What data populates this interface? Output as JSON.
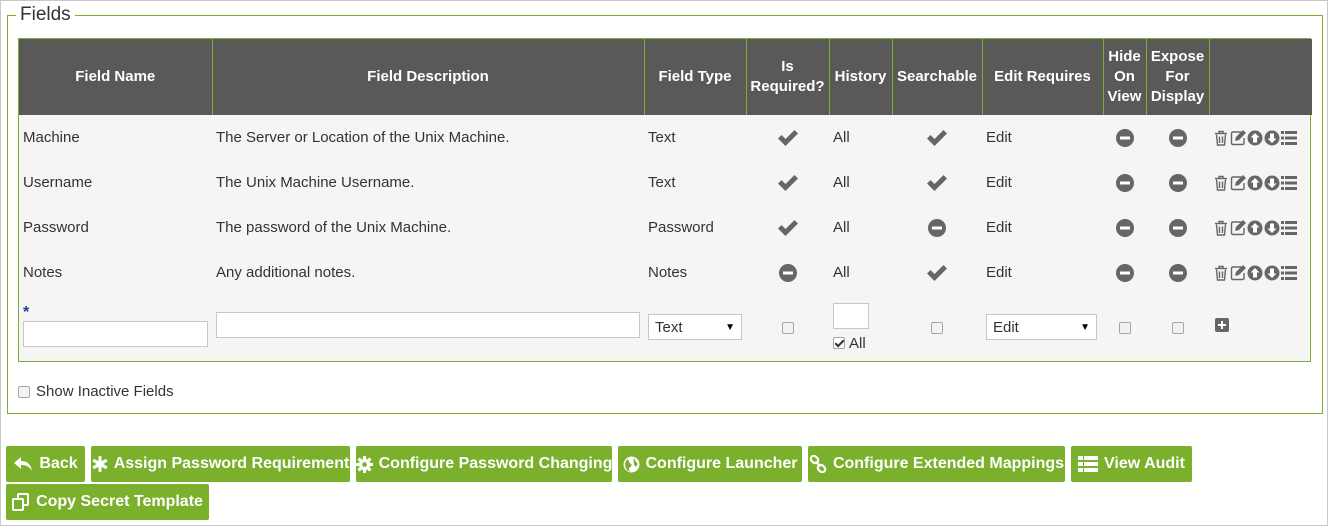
{
  "fieldset": {
    "legend": "Fields"
  },
  "columns": [
    "Field Name",
    "Field Description",
    "Field Type",
    "Is Required?",
    "History",
    "Searchable",
    "Edit Requires",
    "Hide On View",
    "Expose For Display",
    ""
  ],
  "rows": [
    {
      "name": "Machine",
      "description": "The Server or Location of the Unix Machine.",
      "type": "Text",
      "required": true,
      "history": "All",
      "searchable": true,
      "edit_requires": "Edit",
      "hide_on_view": false,
      "expose_for_display": false
    },
    {
      "name": "Username",
      "description": "The Unix Machine Username.",
      "type": "Text",
      "required": true,
      "history": "All",
      "searchable": true,
      "edit_requires": "Edit",
      "hide_on_view": false,
      "expose_for_display": false
    },
    {
      "name": "Password",
      "description": "The password of the Unix Machine.",
      "type": "Password",
      "required": true,
      "history": "All",
      "searchable": false,
      "edit_requires": "Edit",
      "hide_on_view": false,
      "expose_for_display": false
    },
    {
      "name": "Notes",
      "description": "Any additional notes.",
      "type": "Notes",
      "required": false,
      "history": "All",
      "searchable": true,
      "edit_requires": "Edit",
      "hide_on_view": false,
      "expose_for_display": false
    }
  ],
  "new_field": {
    "required_marker": "*",
    "name_value": "",
    "description_value": "",
    "type_selected": "Text",
    "is_required_checked": false,
    "history_value": "",
    "history_all_checked": true,
    "history_all_label": "All",
    "searchable_checked": false,
    "edit_requires_selected": "Edit",
    "hide_on_view_checked": false,
    "expose_for_display_checked": false
  },
  "show_inactive": {
    "label": "Show Inactive Fields",
    "checked": false
  },
  "buttons": {
    "back": "Back",
    "assign_password_requirement": "Assign Password Requirement",
    "configure_password_changing": "Configure Password Changing",
    "configure_launcher": "Configure Launcher",
    "configure_extended_mappings": "Configure Extended Mappings",
    "view_audit": "View Audit",
    "copy_secret_template": "Copy Secret Template"
  },
  "colors": {
    "accent_green": "#7ab02c",
    "header_gray": "#595959",
    "icon_gray": "#666666"
  },
  "icons": {
    "check": "check-icon",
    "minus": "minus-circle-icon",
    "row_actions": [
      "trash-icon",
      "edit-icon",
      "arrow-up-circle-icon",
      "arrow-down-circle-icon",
      "list-icon"
    ]
  }
}
